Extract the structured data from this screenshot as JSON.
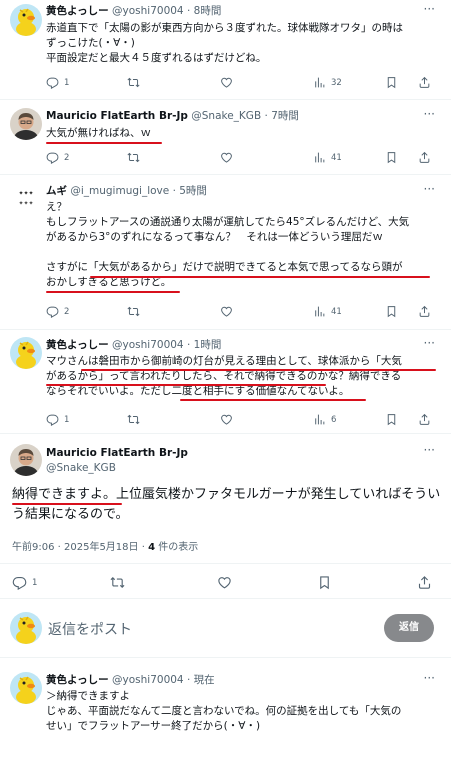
{
  "tweets": [
    {
      "name": "黄色よっしー",
      "handle": "@yoshi70004",
      "dot": "·",
      "time": "8時間",
      "lines": [
        "赤道直下で「太陽の影が東西方向から３度ずれた。球体戦隊オワタ」の時は",
        "ずっこけた(・∀・)",
        "平面設定だと最大４５度ずれるはずだけどね。"
      ],
      "replies": "1",
      "retweets": "",
      "likes": "",
      "views": "32"
    },
    {
      "name": "Mauricio FlatEarth Br-Jp",
      "handle": "@Snake_KGB",
      "dot": "·",
      "time": "7時間",
      "lines": [
        "大気が無ければね、ｗ"
      ],
      "replies": "2",
      "retweets": "",
      "likes": "",
      "views": "41"
    },
    {
      "name": "ムギ",
      "handle": "@i_mugimugi_love",
      "dot": "·",
      "time": "5時間",
      "lines": [
        "え？",
        "もしフラットアースの通説通り太陽が運航してたら45°ズレるんだけど、大気",
        "があるから3°のずれになるって事なん？　それは一体どういう理屈だｗ",
        "",
        "さすがに「大気があるから」だけで説明できてると本気で思ってるなら頭が",
        "おかしすぎると思うけど。"
      ],
      "replies": "2",
      "retweets": "",
      "likes": "",
      "views": "41"
    },
    {
      "name": "黄色よっしー",
      "handle": "@yoshi70004",
      "dot": "·",
      "time": "1時間",
      "lines": [
        "マウさんは磐田市から御前崎の灯台が見える理由として、球体派から「大気",
        "があるから」って言われたりしたら、それで納得できるのかな？納得できる",
        "ならそれでいいよ。ただし二度と相手にする価値なんてないよ。"
      ],
      "replies": "1",
      "retweets": "",
      "likes": "",
      "views": "6"
    }
  ],
  "main": {
    "name": "Mauricio FlatEarth Br-Jp",
    "handle": "@Snake_KGB",
    "lines": [
      "納得できますよ。上位蜃気楼かファタモルガーナが発生していればそうい",
      "う結果になるので。"
    ],
    "timestamp": "午前9:06 · 2025年5月18日 · ",
    "views_count": "4",
    "views_label": " 件の表示",
    "replies": "1"
  },
  "reply_box": {
    "placeholder": "返信をポスト",
    "button": "返信"
  },
  "last": {
    "name": "黄色よっしー",
    "handle": "@yoshi70004",
    "dot": "·",
    "time": "現在",
    "lines": [
      "＞納得できますよ",
      "じゃあ、平面説だなんて二度と言わないでね。何の証拠を出しても「大気の",
      "せい」でフラットアーサー終了だから(・∀・)"
    ]
  },
  "more_label": "···",
  "icons": [
    "reply-icon",
    "retweet-icon",
    "like-icon",
    "views-icon",
    "bookmark-icon",
    "share-icon"
  ],
  "colors": {
    "underline": "#d8101c",
    "muted": "#536471",
    "reply_button": "#87898c"
  }
}
